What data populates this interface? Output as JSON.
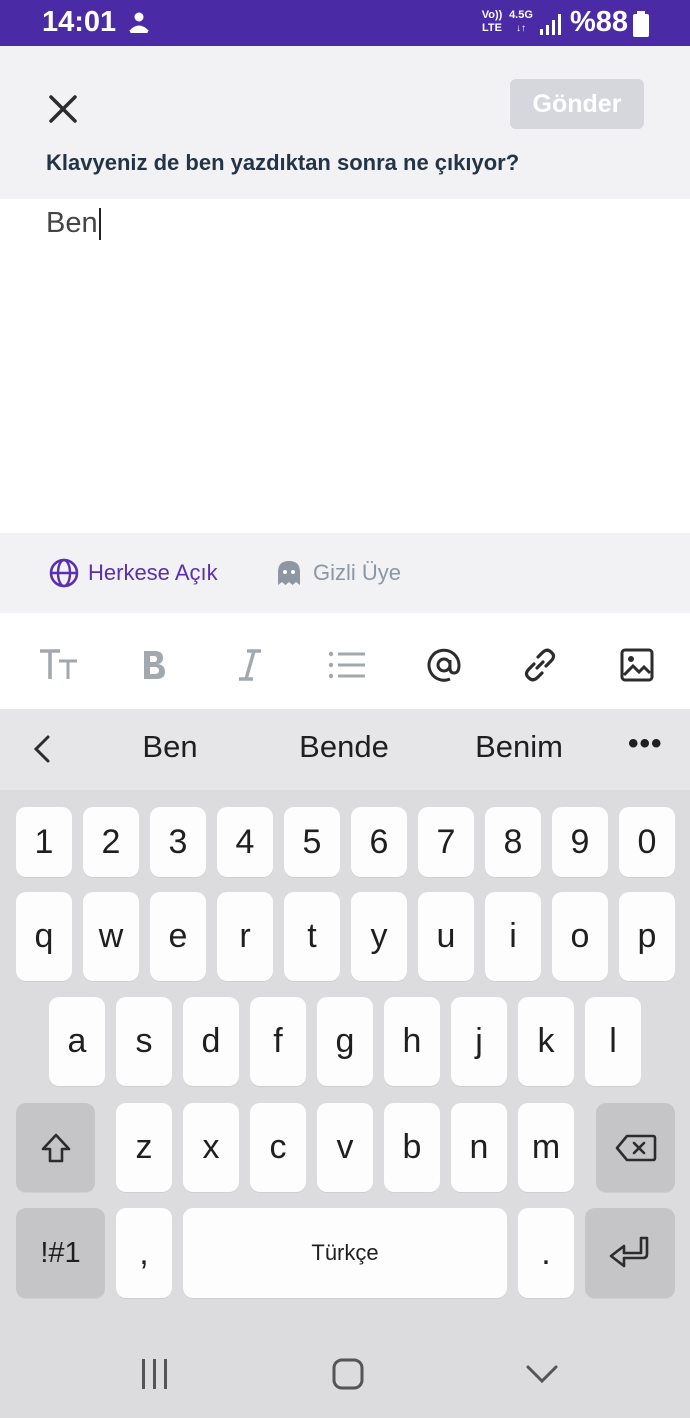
{
  "status_bar": {
    "time": "14:01",
    "volte_line1": "Vo))",
    "volte_line2": "LTE",
    "network": "4.5G",
    "battery": "%88",
    "app_icon": "person-notification-icon",
    "signal_icon": "cell-signal-icon",
    "battery_icon": "battery-icon",
    "background_color": "#4b2aa6"
  },
  "header": {
    "close_icon": "close-icon",
    "send_label": "Gönder",
    "question": "Klavyeniz de ben yazdıktan sonra ne çıkıyor?"
  },
  "compose": {
    "text": "Ben"
  },
  "visibility": {
    "public_label": "Herkese Açık",
    "public_icon": "globe-icon",
    "anonymous_label": "Gizli Üye",
    "anonymous_icon": "ghost-icon",
    "active_color": "#5a2fb0"
  },
  "toolbar": {
    "items": [
      "text-size-icon",
      "bold-icon",
      "italic-icon",
      "bullet-list-icon",
      "mention-icon",
      "link-icon",
      "image-icon"
    ]
  },
  "keyboard": {
    "suggestions": [
      "Ben",
      "Bende",
      "Benim"
    ],
    "more": "•••",
    "number_row": [
      "1",
      "2",
      "3",
      "4",
      "5",
      "6",
      "7",
      "8",
      "9",
      "0"
    ],
    "row1": [
      "q",
      "w",
      "e",
      "r",
      "t",
      "y",
      "u",
      "i",
      "o",
      "p"
    ],
    "row2": [
      "a",
      "s",
      "d",
      "f",
      "g",
      "h",
      "j",
      "k",
      "l"
    ],
    "row3": [
      "z",
      "x",
      "c",
      "v",
      "b",
      "n",
      "m"
    ],
    "symbols_label": "!#1",
    "comma": ",",
    "space_label": "Türkçe",
    "period": ".",
    "shift_icon": "shift-icon",
    "backspace_icon": "backspace-icon",
    "enter_icon": "enter-icon"
  },
  "nav_bar": {
    "items": [
      "recent-apps-icon",
      "home-icon",
      "back-icon"
    ]
  }
}
